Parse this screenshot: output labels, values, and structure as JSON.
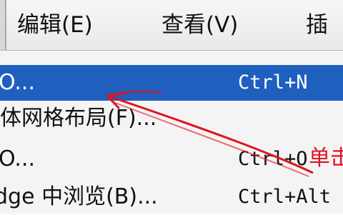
{
  "menubar": {
    "items": [
      {
        "label": "编辑(E)"
      },
      {
        "label": "查看(V)"
      },
      {
        "label": "插"
      }
    ]
  },
  "menu": {
    "items": [
      {
        "label": "O...",
        "shortcut": "Ctrl+N",
        "selected": true
      },
      {
        "label": "体网格布局(F)...",
        "shortcut": "",
        "selected": false
      },
      {
        "label": "O...",
        "shortcut": "Ctrl+O",
        "selected": false
      },
      {
        "label": "dge 中浏览(B)...",
        "shortcut": "Ctrl+Alt",
        "selected": false
      }
    ]
  },
  "annotation": {
    "text": "单击",
    "color": "#e0131f"
  },
  "colors": {
    "selection": "#1f5fbe",
    "menu_background": "#f4f4f4",
    "menubar_background": "#eeeeee"
  }
}
